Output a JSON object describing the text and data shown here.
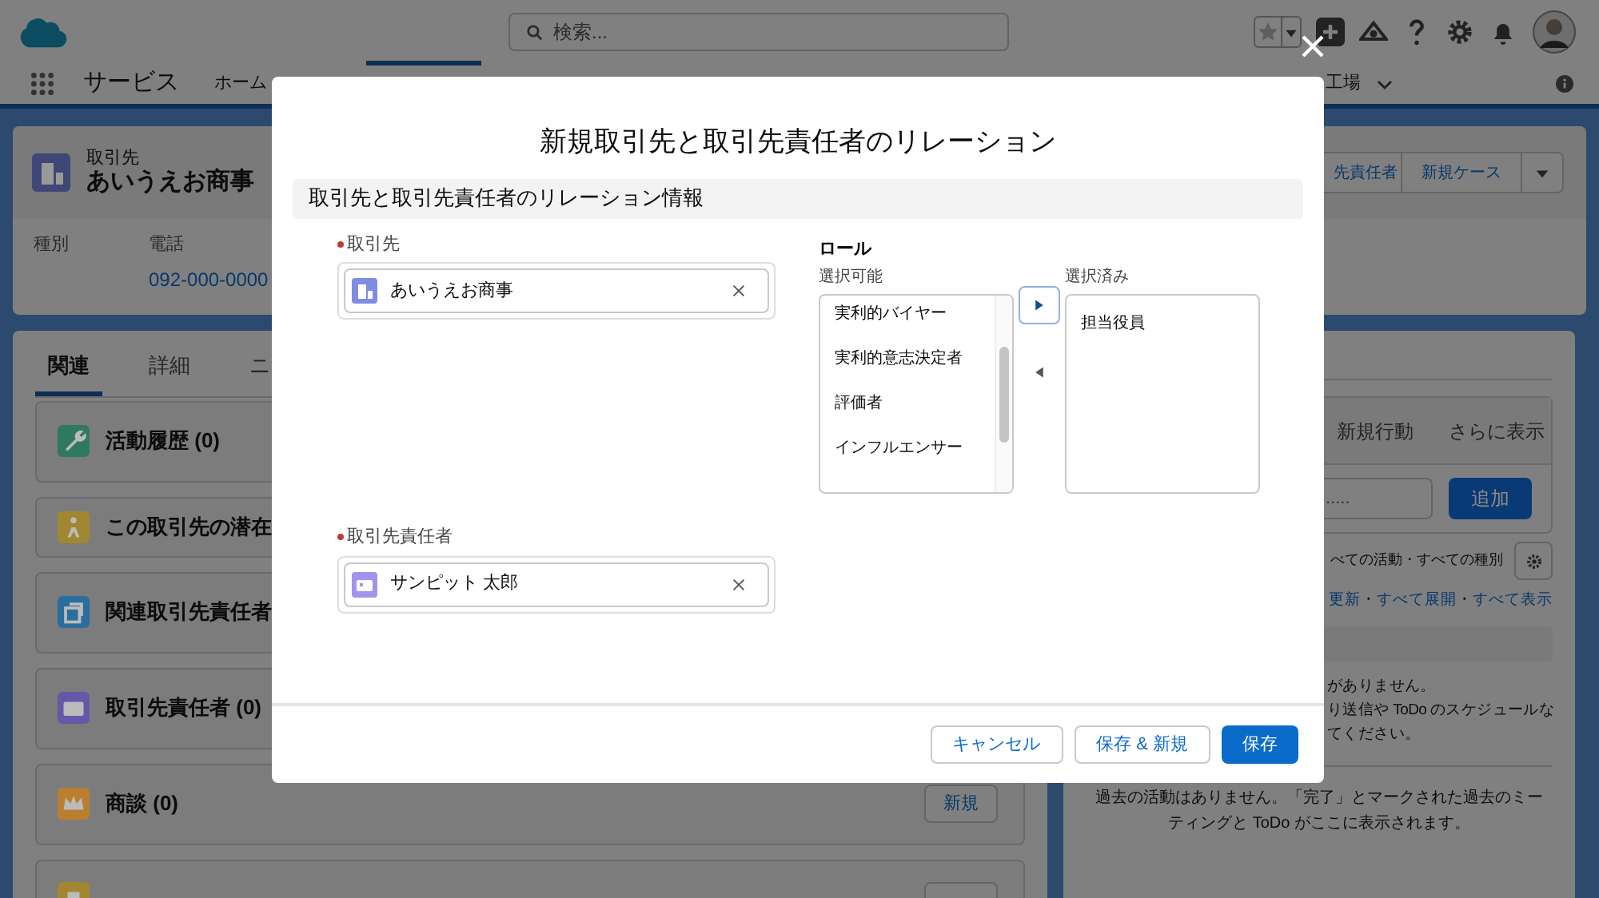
{
  "header": {
    "search_placeholder": "検索..."
  },
  "nav": {
    "app_name": "サービス",
    "items": [
      {
        "label": "ホーム"
      },
      {
        "label": "工場",
        "dropdown": true
      }
    ]
  },
  "record": {
    "object_label": "取引先",
    "name": "あいうえお商事",
    "fields": [
      {
        "label": "種別"
      },
      {
        "label": "電話",
        "value": "092-000-0000"
      }
    ],
    "actions": [
      "先責任者",
      "新規ケース"
    ]
  },
  "tabs": [
    {
      "label": "関連",
      "selected": true
    },
    {
      "label": "詳細",
      "selected": false
    },
    {
      "label": "ニ",
      "selected": false
    }
  ],
  "related_lists": [
    {
      "title": "活動履歴 (0)",
      "kind": "wrench",
      "color": "#2f7a5f"
    },
    {
      "title": "この取引先の潜在",
      "kind": "person",
      "color": "#a08730"
    },
    {
      "title": "関連取引先責任者",
      "kind": "stack",
      "color": "#2a6e9e"
    },
    {
      "title": "取引先責任者 (0)",
      "kind": "card",
      "color": "#6657a8"
    },
    {
      "title": "商談 (0)",
      "kind": "crown",
      "color": "#b97f2f",
      "button": "新規"
    },
    {
      "kind": "other",
      "color": "#a08730",
      "has_button": true
    }
  ],
  "activity": {
    "tabs": [
      "新規行動",
      "さらに表示"
    ],
    "placeholder": ".....",
    "add_button": "追加",
    "filter": "べての活動・すべての種別",
    "links": [
      "更新",
      "すべて展開",
      "すべて表示"
    ],
    "separator": "・",
    "upcoming_lines": [
      "がありません。",
      "り送信や ToDo のスケジュールな",
      "てください。"
    ],
    "past": "過去の活動はありません。「完了」とマークされた過去のミーティングと ToDo がここに表示されます。"
  },
  "modal": {
    "title": "新規取引先と取引先責任者のリレーション",
    "section": "取引先と取引先責任者のリレーション情報",
    "fields": [
      {
        "label": "取引先",
        "required": true,
        "value": "あいうえお商事",
        "kind": "account"
      },
      {
        "label": "取引先責任者",
        "required": true,
        "value": "サンピット 太郎",
        "kind": "contact"
      }
    ],
    "role": {
      "label": "ロール",
      "available_label": "選択可能",
      "available": [
        "実利的バイヤー",
        "実利的意志決定者",
        "評価者",
        "インフルエンサー"
      ],
      "selected_label": "選択済み",
      "selected": [
        "担当役員"
      ]
    },
    "buttons": [
      {
        "label": "キャンセル",
        "kind": "neutral"
      },
      {
        "label": "保存 & 新規",
        "kind": "neutral"
      },
      {
        "label": "保存",
        "kind": "brand"
      }
    ]
  }
}
